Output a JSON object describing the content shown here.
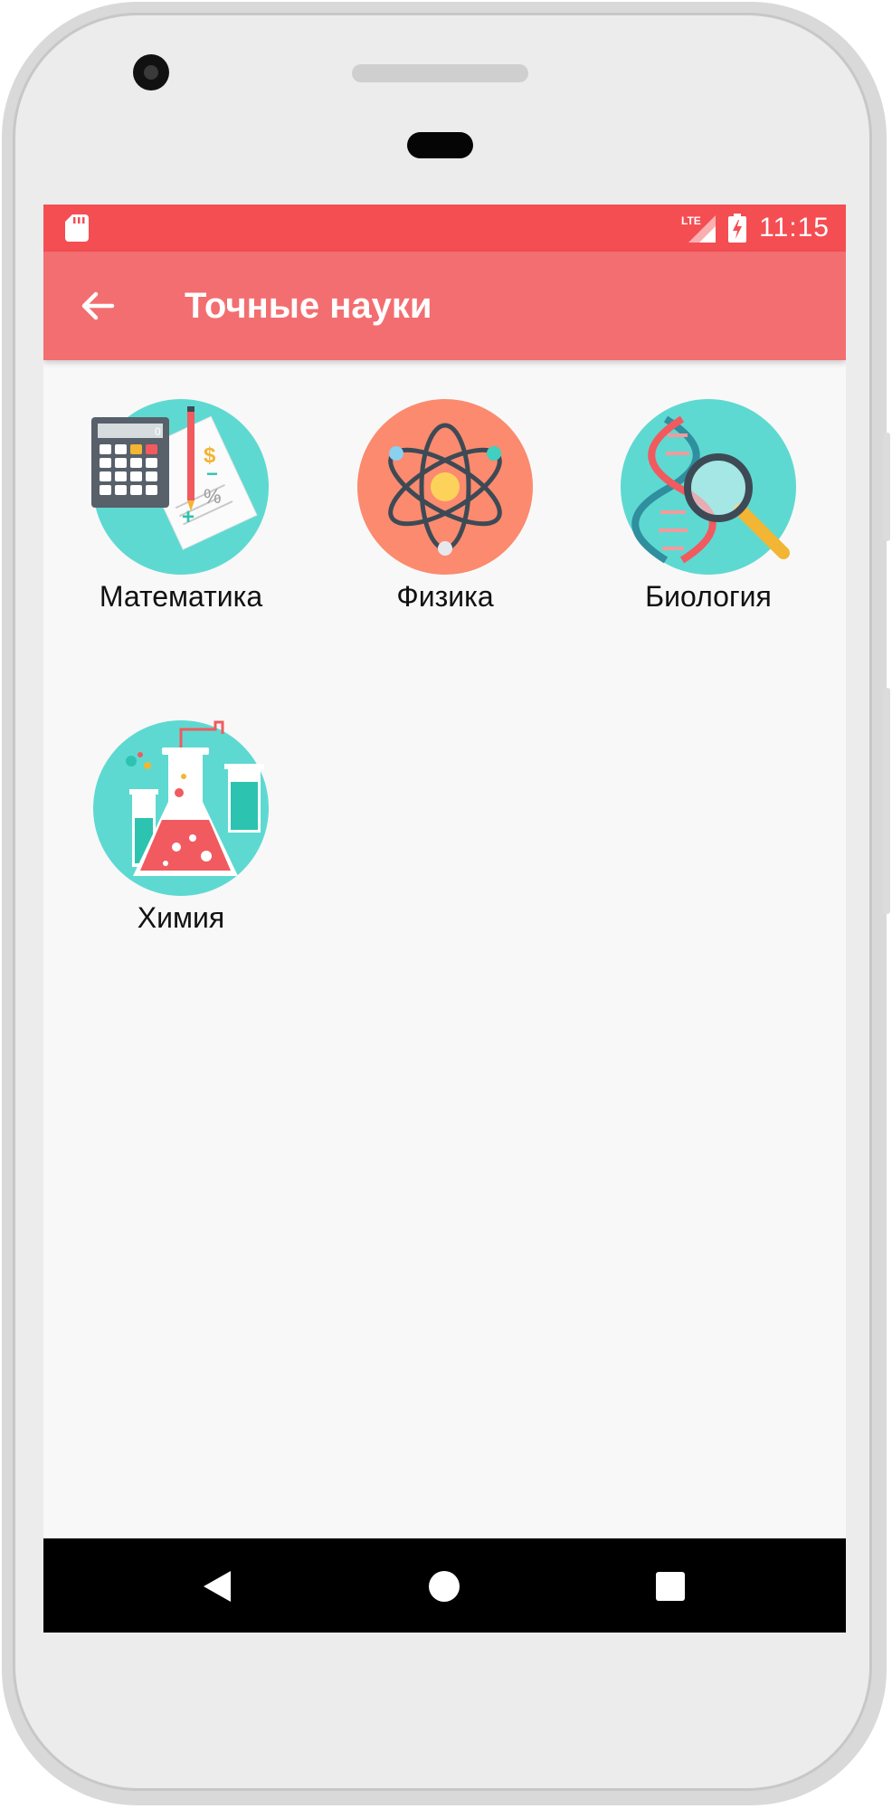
{
  "status_bar": {
    "time": "11:15",
    "network": "LTE",
    "color": "#f44e53"
  },
  "app_bar": {
    "title": "Точные науки",
    "back_icon": "arrow-left-icon",
    "color": "#f36e70"
  },
  "subjects": [
    {
      "label": "Математика",
      "icon": "calculator-icon",
      "circle_color": "#5ed9d1"
    },
    {
      "label": "Физика",
      "icon": "atom-icon",
      "circle_color": "#fb8a6e"
    },
    {
      "label": "Биология",
      "icon": "dna-magnifier-icon",
      "circle_color": "#5ed9d1"
    },
    {
      "label": "Химия",
      "icon": "flask-icon",
      "circle_color": "#5ed9d1"
    }
  ],
  "calculator_display": "0",
  "nav_bar": {
    "back_icon": "nav-back-icon",
    "home_icon": "nav-home-icon",
    "recents_icon": "nav-recents-icon"
  }
}
